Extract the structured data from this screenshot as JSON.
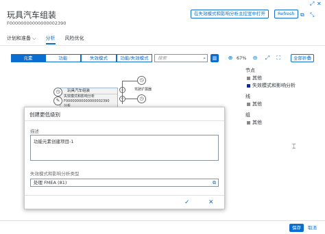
{
  "header": {
    "title": "玩具汽车组装",
    "subtitle": "F00000000000000002390",
    "open_in_app_button": "在失效模式和影响分析主控室中打开",
    "refresh_button": "Refresh"
  },
  "tabs": [
    {
      "label": "计划和准备 ⌵",
      "active": false
    },
    {
      "label": "分析",
      "active": true
    },
    {
      "label": "风险优化",
      "active": false
    }
  ],
  "toolbar": {
    "segments": [
      "元素",
      "功能",
      "失效模式",
      "功能/失效模式"
    ],
    "selected_segment": "元素",
    "search_placeholder": "搜索",
    "zoom_level": "67%",
    "collapse_all": "全部折叠"
  },
  "canvas": {
    "node_title": "玩具汽车组装",
    "node_rows": [
      "失效模式和影响分析",
      "F00000000000000002390",
      "分析"
    ],
    "side_node_label": "驾驶扩展器"
  },
  "legend": {
    "nodes_heading": "节点",
    "nodes_items": [
      {
        "label": "其他",
        "color": "#888888"
      },
      {
        "label": "失效模式和影响分析",
        "color": "#0a2a9e"
      }
    ],
    "lines_heading": "线",
    "lines_items": [
      {
        "label": "其他",
        "color": "#888888"
      }
    ],
    "groups_heading": "组",
    "groups_items": [
      {
        "label": "其他",
        "color": "#888888"
      }
    ]
  },
  "dialog": {
    "title": "创建更低级别",
    "description_label": "描述",
    "description_value": "功能元素创建项目-1",
    "type_label": "失效模式和影响分析类型",
    "type_value": "处理 FMEA (81)",
    "confirm_icon": "✓",
    "close_icon": "✕"
  },
  "footer": {
    "save_button": "保存",
    "cancel_button": "取消"
  },
  "colors": {
    "accent": "#0a6ed1",
    "fmea_legend": "#0a2a9e"
  }
}
